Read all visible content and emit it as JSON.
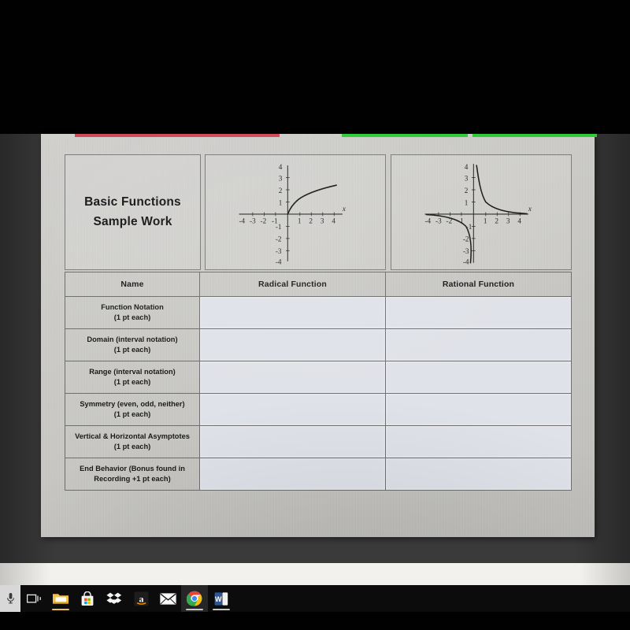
{
  "document": {
    "title_line_1": "Basic Functions",
    "title_line_2": "Sample Work"
  },
  "highlights": {
    "red_mark_color": "#cf3242",
    "green_mark_color": "#2ecc34"
  },
  "graphs": [
    {
      "name": "radical-function-graph",
      "axis_label_x": "x",
      "x_ticks": [
        "-4",
        "-3",
        "-2",
        "-1",
        "1",
        "2",
        "3",
        "4"
      ],
      "y_ticks": [
        "4",
        "3",
        "2",
        "1",
        "-1",
        "-2",
        "-3",
        "-4"
      ],
      "curve": "square-root"
    },
    {
      "name": "rational-function-graph",
      "axis_label_x": "x",
      "x_ticks": [
        "-4",
        "-3",
        "-2",
        "-1",
        "1",
        "2",
        "3",
        "4"
      ],
      "y_ticks": [
        "4",
        "3",
        "2",
        "1",
        "-1",
        "-2",
        "-3",
        "-4"
      ],
      "curve": "reciprocal"
    }
  ],
  "table": {
    "headers": [
      "Name",
      "Radical Function",
      "Rational Function"
    ],
    "rows": [
      {
        "label_line_1": "Function Notation",
        "label_line_2": "(1 pt each)",
        "radical": "",
        "rational": ""
      },
      {
        "label_line_1": "Domain (interval notation)",
        "label_line_2": "(1 pt each)",
        "radical": "",
        "rational": ""
      },
      {
        "label_line_1": "Range (interval notation)",
        "label_line_2": "(1 pt each)",
        "radical": "",
        "rational": ""
      },
      {
        "label_line_1": "Symmetry (even, odd, neither)",
        "label_line_2": "(1 pt each)",
        "radical": "",
        "rational": ""
      },
      {
        "label_line_1": "Vertical & Horizontal Asymptotes",
        "label_line_2": "(1 pt each)",
        "radical": "",
        "rational": ""
      },
      {
        "label_line_1": "End Behavior (Bonus found in",
        "label_line_2": "Recording +1 pt each)",
        "radical": "",
        "rational": ""
      }
    ]
  },
  "taskbar": {
    "items": [
      {
        "icon": "microphone-icon",
        "label": "Cortana"
      },
      {
        "icon": "task-view-icon",
        "label": "Task View"
      },
      {
        "icon": "file-explorer-icon",
        "label": "File Explorer"
      },
      {
        "icon": "microsoft-store-icon",
        "label": "Microsoft Store"
      },
      {
        "icon": "dropbox-icon",
        "label": "Dropbox"
      },
      {
        "icon": "amazon-icon",
        "label": "Amazon"
      },
      {
        "icon": "mail-icon",
        "label": "Mail"
      },
      {
        "icon": "chrome-icon",
        "label": "Google Chrome"
      },
      {
        "icon": "word-icon",
        "label": "Microsoft Word"
      }
    ]
  }
}
